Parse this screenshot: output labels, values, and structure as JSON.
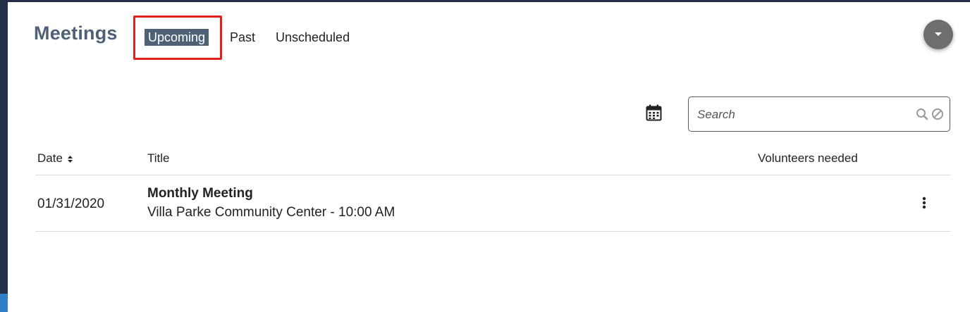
{
  "header": {
    "title": "Meetings",
    "tabs": [
      {
        "label": "Upcoming",
        "active": true
      },
      {
        "label": "Past",
        "active": false
      },
      {
        "label": "Unscheduled",
        "active": false
      }
    ],
    "menu_icon": "chevron-down-icon"
  },
  "toolbar": {
    "calendar_icon": "calendar-icon",
    "search": {
      "placeholder": "Search",
      "value": "",
      "icons": [
        "search-icon",
        "clear-icon"
      ]
    }
  },
  "table": {
    "columns": [
      "Date",
      "Title",
      "Volunteers needed"
    ],
    "sort_icon": "sort-icon",
    "rows": [
      {
        "date": "01/31/2020",
        "title": "Monthly Meeting",
        "subtitle": "Villa Parke Community Center - 10:00 AM",
        "volunteers_needed": "",
        "actions_icon": "kebab-menu-icon"
      }
    ]
  },
  "colors": {
    "accent": "#4f6177",
    "highlight": "#e0211d",
    "rail": "#24304a",
    "fab": "#6e6e6e"
  }
}
